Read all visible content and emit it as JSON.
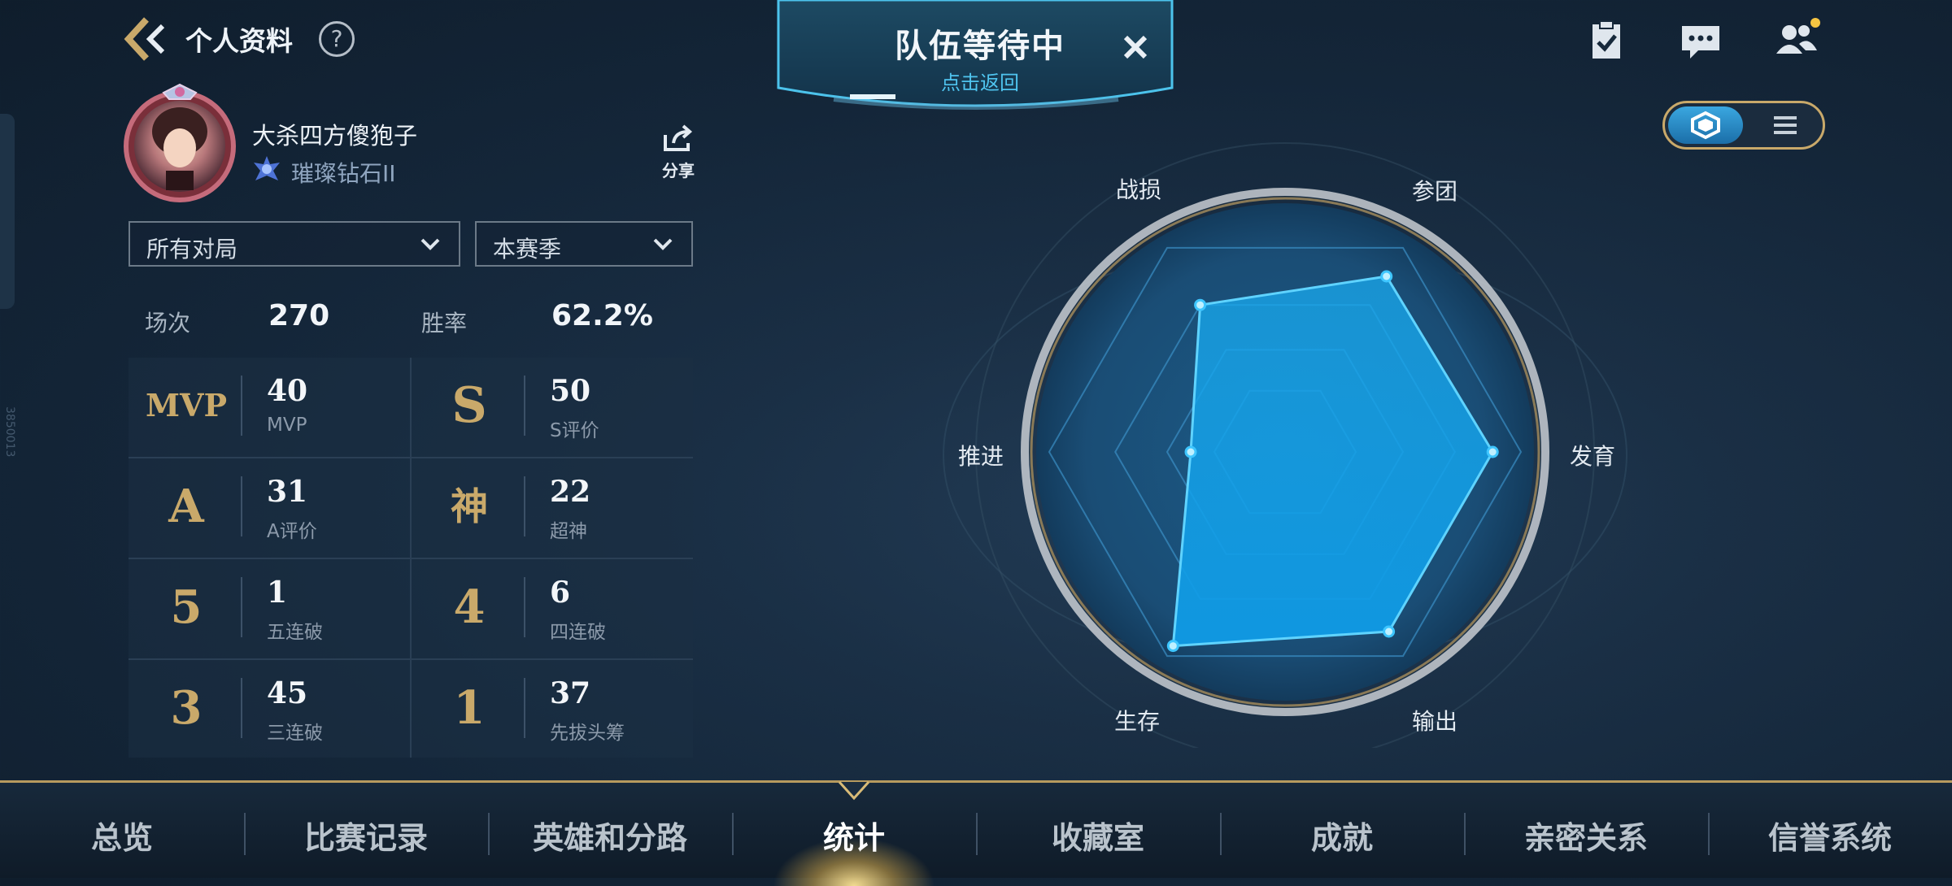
{
  "header": {
    "title": "个人资料",
    "help": "?"
  },
  "team_banner": {
    "title": "队伍等待中",
    "subtitle": "点击返回"
  },
  "top_icons": [
    "task-clipboard-icon",
    "chat-icon",
    "friends-icon"
  ],
  "profile": {
    "username": "大杀四方傻狍子",
    "rank": "璀璨钻石II",
    "share_label": "分享"
  },
  "filters": {
    "mode": "所有对局",
    "season": "本赛季"
  },
  "summary": {
    "matches_label": "场次",
    "matches_value": "270",
    "winrate_label": "胜率",
    "winrate_value": "62.2%"
  },
  "stats": [
    {
      "symbol": "MVP",
      "value": "40",
      "label": "MVP"
    },
    {
      "symbol": "S",
      "value": "50",
      "label": "S评价"
    },
    {
      "symbol": "A",
      "value": "31",
      "label": "A评价"
    },
    {
      "symbol": "神",
      "value": "22",
      "label": "超神"
    },
    {
      "symbol": "5",
      "value": "1",
      "label": "五连破"
    },
    {
      "symbol": "4",
      "value": "6",
      "label": "四连破"
    },
    {
      "symbol": "3",
      "value": "45",
      "label": "三连破"
    },
    {
      "symbol": "1",
      "value": "37",
      "label": "先拔头筹"
    }
  ],
  "radar": {
    "axes": [
      "战损",
      "参团",
      "发育",
      "输出",
      "生存",
      "推进"
    ],
    "values": [
      0.72,
      0.86,
      0.88,
      0.88,
      0.95,
      0.4
    ]
  },
  "side_id": "3850013",
  "nav": {
    "items": [
      "总览",
      "比赛记录",
      "英雄和分路",
      "统计",
      "收藏室",
      "成就",
      "亲密关系",
      "信誉系统"
    ],
    "active": "统计"
  },
  "colors": {
    "accent": "#1fa6e6",
    "gold": "#c9a96a"
  }
}
